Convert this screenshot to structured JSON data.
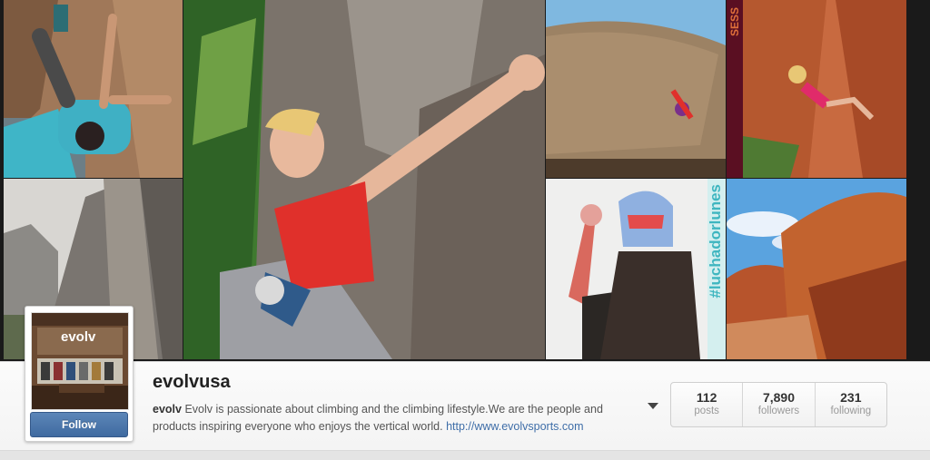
{
  "profile": {
    "username": "evolvusa",
    "bio_name": "evolv",
    "bio_text": " Evolv is passionate about climbing and the climbing lifestyle.We are the people and products inspiring everyone who enjoys the vertical world. ",
    "website": "http://www.evolvsports.com",
    "follow_label": "Follow",
    "avatar_sign": "evolv"
  },
  "stats": [
    {
      "value": "112",
      "label": "posts"
    },
    {
      "value": "7,890",
      "label": "followers"
    },
    {
      "value": "231",
      "label": "following"
    }
  ],
  "photo_tags": {
    "luchador": "#luchadorlunes",
    "edge_banner": "SESS"
  },
  "colors": {
    "follow_button": "#4a76ab",
    "link": "#3f6ea8",
    "climber_top": "#e0302b"
  }
}
